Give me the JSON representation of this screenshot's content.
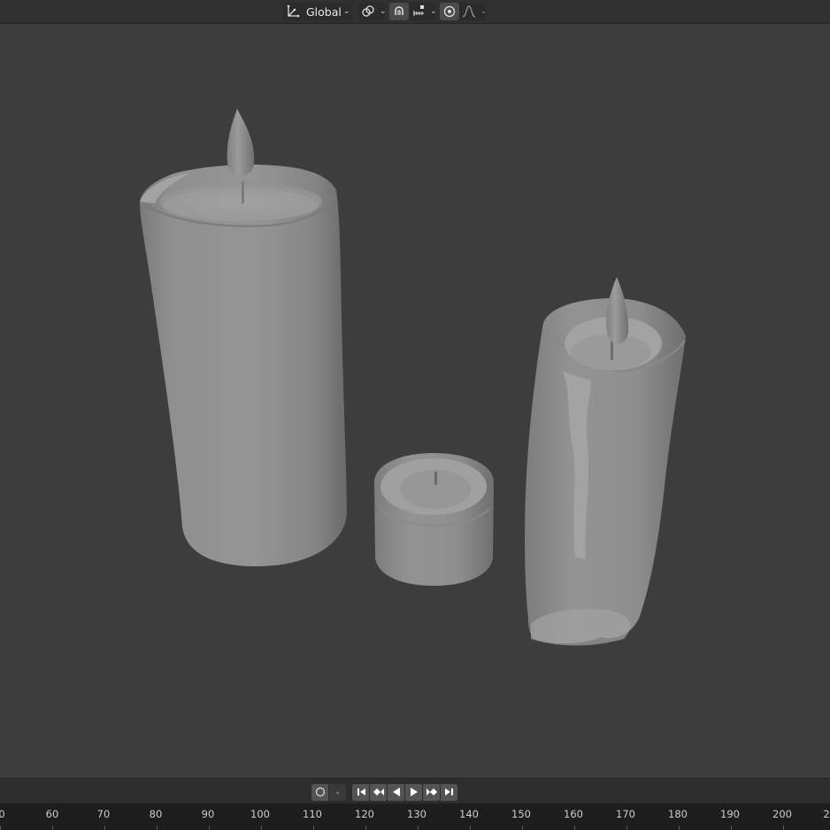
{
  "header": {
    "transform_orientation_label": "Global",
    "icons": {
      "orientation": "transform-orientation-icon",
      "pivot": "pivot-point-icon",
      "snap": "snap-magnet-icon",
      "snap_target": "snap-increment-icon",
      "proportional": "proportional-editing-icon",
      "falloff": "falloff-curve-icon"
    }
  },
  "viewport": {
    "objects": [
      "tall-candle",
      "small-tea-candle",
      "melted-candle"
    ],
    "background_color": "#3d3d3d",
    "object_color": "#8c8c8c"
  },
  "timeline": {
    "controls": {
      "keyframe_toggle_icon": "record-circle-icon",
      "playback_buttons": [
        "jump-start-icon",
        "prev-keyframe-icon",
        "play-reverse-icon",
        "play-icon",
        "next-keyframe-icon",
        "jump-end-icon"
      ]
    },
    "ruler": {
      "labels": [
        "0",
        "60",
        "70",
        "80",
        "90",
        "100",
        "110",
        "120",
        "130",
        "140",
        "150",
        "160",
        "170",
        "180",
        "190",
        "200",
        "2"
      ]
    }
  }
}
